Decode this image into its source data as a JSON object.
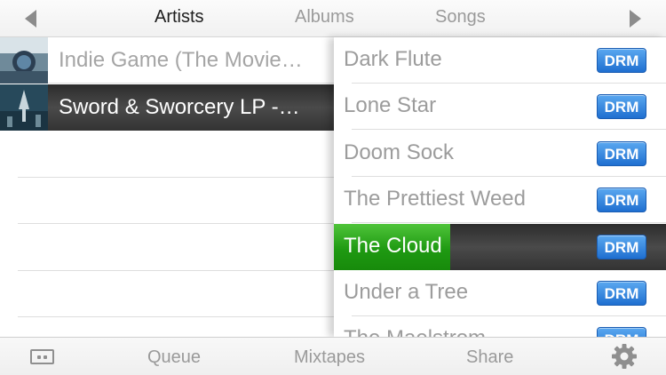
{
  "tabs": {
    "artists": "Artists",
    "albums": "Albums",
    "songs": "Songs",
    "active": "artists"
  },
  "albums": [
    {
      "title": "Indie Game (The Movie…",
      "selected": false,
      "cover_icon": "album-cover-indie-game"
    },
    {
      "title": "Sword & Sworcery LP -…",
      "selected": true,
      "cover_icon": "album-cover-sword-sworcery"
    }
  ],
  "tracks": [
    {
      "name": "Dark Flute",
      "badge": "DRM"
    },
    {
      "name": "Lone Star",
      "badge": "DRM"
    },
    {
      "name": "Doom Sock",
      "badge": "DRM"
    },
    {
      "name": "The Prettiest Weed",
      "badge": "DRM"
    },
    {
      "name": "The Cloud",
      "badge": "DRM",
      "playing": true,
      "progress": 0.35
    },
    {
      "name": "Under a Tree",
      "badge": "DRM"
    },
    {
      "name": "The Maelstrom",
      "badge": "DRM"
    }
  ],
  "toolbar": {
    "queue": "Queue",
    "mixtapes": "Mixtapes",
    "share": "Share",
    "left_icon": "cassette-icon",
    "right_icon": "gear-icon"
  },
  "colors": {
    "accent_green": "#1f9a12",
    "drm_blue": "#1f6fd0",
    "selected_dark": "#3a3a3a"
  }
}
